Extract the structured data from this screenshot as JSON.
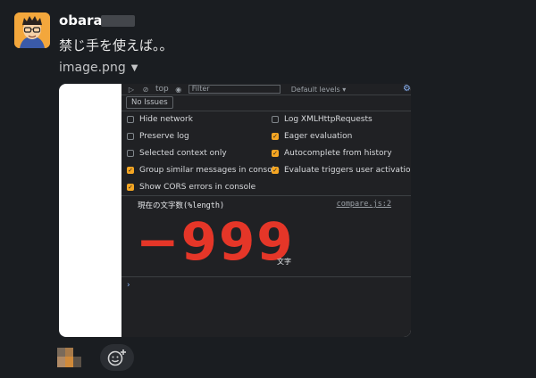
{
  "message": {
    "author": "obara",
    "text": "禁じ手を使えば。。",
    "attachment_name": "image.png"
  },
  "devtools": {
    "context": "top",
    "filter_placeholder": "Filter",
    "levels_label": "Default levels ▾",
    "no_issues": "No Issues",
    "settings": [
      {
        "label": "Hide network",
        "checked": false
      },
      {
        "label": "Log XMLHttpRequests",
        "checked": false
      },
      {
        "label": "Preserve log",
        "checked": false
      },
      {
        "label": "Eager evaluation",
        "checked": true
      },
      {
        "label": "Selected context only",
        "checked": false
      },
      {
        "label": "Autocomplete from history",
        "checked": true
      },
      {
        "label": "Group similar messages in console",
        "checked": true
      },
      {
        "label": "Evaluate triggers user activation",
        "checked": true
      },
      {
        "label": "Show CORS errors in console",
        "checked": true
      }
    ],
    "log_label": "現在の文字数(%length)",
    "log_source": "compare.js:2",
    "log_value": "−999",
    "log_unit": "文字",
    "prompt": "›"
  },
  "colors": {
    "background": "#1a1d21",
    "devtools_bg": "#202124",
    "accent_checkbox": "#f5a623",
    "value_red": "#e53628",
    "link_blue": "#8ab4f8"
  },
  "icons": [
    "avatar",
    "caret-down-icon",
    "sidebar-toggle-icon",
    "clear-console-icon",
    "eye-icon",
    "gear-icon",
    "add-reaction-icon"
  ]
}
